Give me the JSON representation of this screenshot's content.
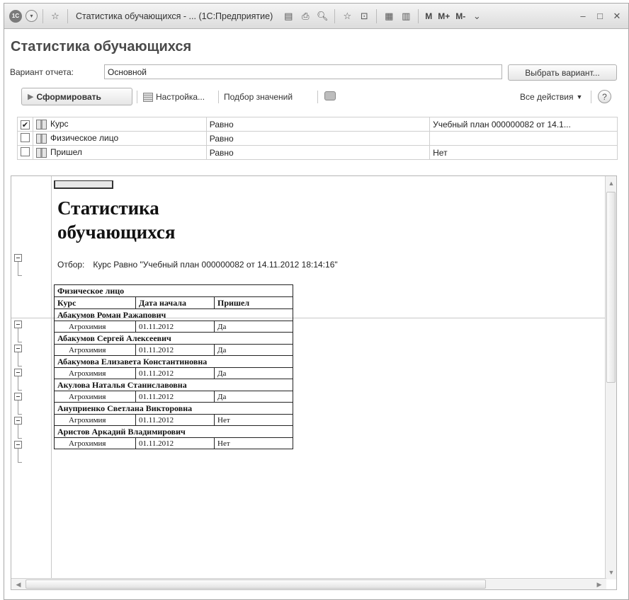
{
  "titlebar": {
    "title": "Статистика обучающихся - ...  (1С:Предприятие)",
    "logo": "1С",
    "m_labels": [
      "M",
      "M+",
      "M-"
    ]
  },
  "form": {
    "heading": "Статистика обучающихся",
    "variant_label": "Вариант отчета:",
    "variant_value": "Основной",
    "select_variant": "Выбрать вариант...",
    "generate": "Сформировать",
    "settings": "Настройка...",
    "pick_values": "Подбор значений",
    "all_actions": "Все действия",
    "help": "?"
  },
  "filters": [
    {
      "checked": true,
      "field": "Курс",
      "condition": "Равно",
      "value": "Учебный план 000000082 от 14.1..."
    },
    {
      "checked": false,
      "field": "Физическое лицо",
      "condition": "Равно",
      "value": ""
    },
    {
      "checked": false,
      "field": "Пришел",
      "condition": "Равно",
      "value": "Нет"
    }
  ],
  "report": {
    "title_line1": "Статистика",
    "title_line2": "обучающихся",
    "filter_label": "Отбор:",
    "filter_text": "Курс Равно \"Учебный план 000000082 от 14.11.2012 18:14:16\"",
    "header_group": "Физическое лицо",
    "col_course": "Курс",
    "col_start": "Дата начала",
    "col_came": "Пришел",
    "rows": [
      {
        "name": "Абакумов Роман Ражапович",
        "course": "Агрохимия",
        "date": "01.11.2012",
        "came": "Да"
      },
      {
        "name": "Абакумов Сергей Алексеевич",
        "course": "Агрохимия",
        "date": "01.11.2012",
        "came": "Да"
      },
      {
        "name": "Абакумова Елизавета Константиновна",
        "course": "Агрохимия",
        "date": "01.11.2012",
        "came": "Да"
      },
      {
        "name": "Акулова Наталья Станиславовна",
        "course": "Агрохимия",
        "date": "01.11.2012",
        "came": "Да"
      },
      {
        "name": "Ануприенко Светлана Викторовна",
        "course": "Агрохимия",
        "date": "01.11.2012",
        "came": "Нет"
      },
      {
        "name": "Аристов Аркадий Владимирович",
        "course": "Агрохимия",
        "date": "01.11.2012",
        "came": "Нет"
      }
    ]
  }
}
